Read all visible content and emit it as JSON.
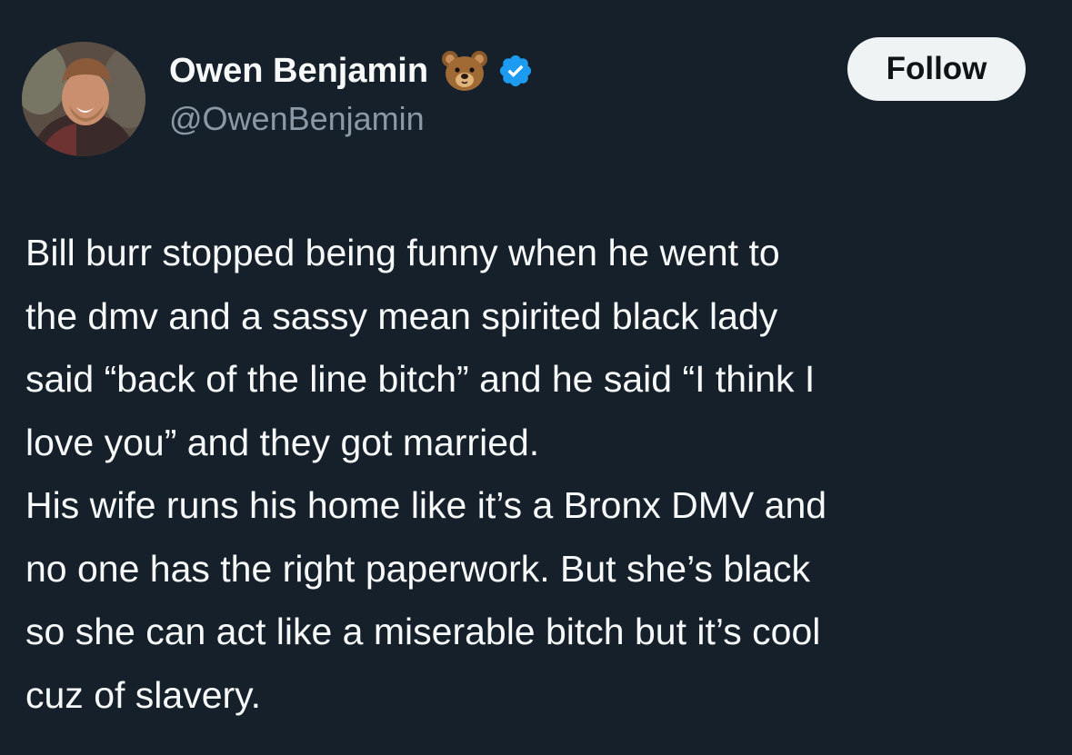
{
  "author": {
    "display_name": "Owen Benjamin",
    "handle": "@OwenBenjamin",
    "emoji_icon": "bear-face-icon",
    "verified_icon": "verified-badge-icon",
    "verified_color": "#1d9bf0"
  },
  "actions": {
    "follow_label": "Follow"
  },
  "tweet": {
    "paragraph_1": "Bill burr stopped being funny when he went to\nthe dmv and a sassy mean spirited black lady\nsaid “back of the line bitch” and he said “I think I\nlove you” and they got married.",
    "paragraph_2": "His wife runs his home like it’s a Bronx DMV and\nno one has the right paperwork. But she’s black\nso she can act like a miserable bitch but it’s cool\ncuz of slavery."
  },
  "colors": {
    "background": "#15202b",
    "text_primary": "#f7f9f9",
    "text_secondary": "#8b98a5",
    "button_bg": "#eff3f4",
    "button_text": "#0f1419"
  }
}
